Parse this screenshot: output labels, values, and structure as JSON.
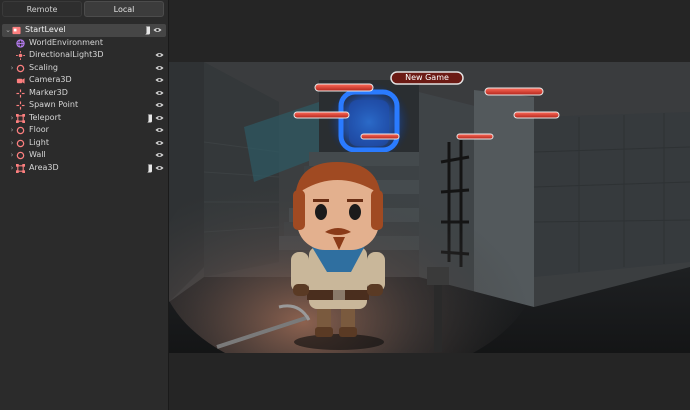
{
  "tabs": [
    {
      "label": "Remote",
      "active": false
    },
    {
      "label": "Local",
      "active": true
    }
  ],
  "tree": [
    {
      "label": "StartLevel",
      "icon": "node-3d-scene-icon",
      "color": "#fc7f7f",
      "expand": "open",
      "depth": 0,
      "script": true,
      "visible": true,
      "selected": true
    },
    {
      "label": "WorldEnvironment",
      "icon": "world-environment-icon",
      "color": "#b77cf2",
      "expand": "none",
      "depth": 1,
      "script": false,
      "visible": false
    },
    {
      "label": "DirectionalLight3D",
      "icon": "directional-light-icon",
      "color": "#fc7f7f",
      "expand": "none",
      "depth": 1,
      "script": false,
      "visible": true
    },
    {
      "label": "Scaling",
      "icon": "node-3d-icon",
      "color": "#fc7f7f",
      "expand": "closed",
      "depth": 1,
      "script": false,
      "visible": true
    },
    {
      "label": "Camera3D",
      "icon": "camera-icon",
      "color": "#fc7f7f",
      "expand": "none",
      "depth": 1,
      "script": false,
      "visible": true
    },
    {
      "label": "Marker3D",
      "icon": "marker-icon",
      "color": "#fc7f7f",
      "expand": "none",
      "depth": 1,
      "script": false,
      "visible": true
    },
    {
      "label": "Spawn Point",
      "icon": "marker-icon",
      "color": "#fc7f7f",
      "expand": "none",
      "depth": 1,
      "script": false,
      "visible": true
    },
    {
      "label": "Teleport",
      "icon": "area-icon",
      "color": "#fc7f7f",
      "expand": "closed",
      "depth": 1,
      "script": true,
      "visible": true
    },
    {
      "label": "Floor",
      "icon": "node-3d-icon",
      "color": "#fc7f7f",
      "expand": "closed",
      "depth": 1,
      "script": false,
      "visible": true
    },
    {
      "label": "Light",
      "icon": "node-3d-icon",
      "color": "#fc7f7f",
      "expand": "closed",
      "depth": 1,
      "script": false,
      "visible": true
    },
    {
      "label": "Wall",
      "icon": "node-3d-icon",
      "color": "#fc7f7f",
      "expand": "closed",
      "depth": 1,
      "script": false,
      "visible": true
    },
    {
      "label": "Area3D",
      "icon": "area-icon",
      "color": "#fc7f7f",
      "expand": "closed",
      "depth": 1,
      "script": true,
      "visible": true
    }
  ],
  "game": {
    "menu_button_label": "New Game"
  },
  "colors": {
    "accent_red": "#c0392b",
    "portal_blue": "#1e7bff",
    "eye_icon": "#d0d0d0"
  }
}
